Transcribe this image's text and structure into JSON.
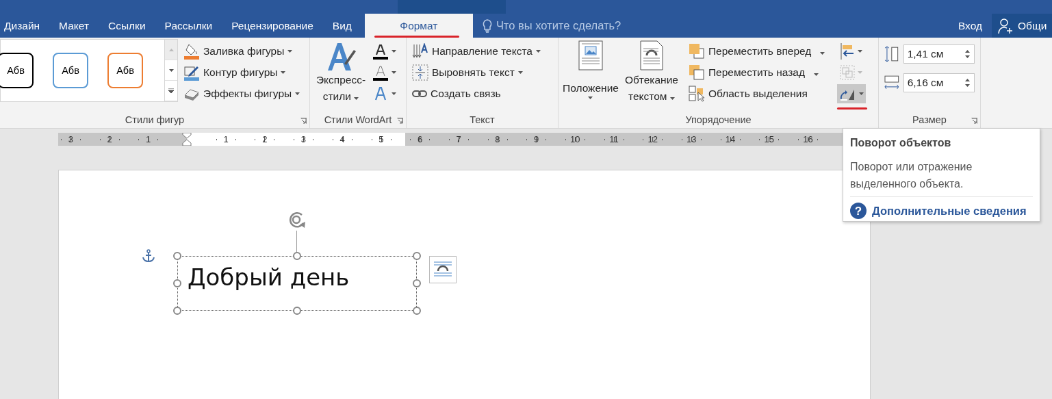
{
  "ribbon_tabs": [
    {
      "label": "Дизайн",
      "selected": false
    },
    {
      "label": "Макет",
      "selected": false
    },
    {
      "label": "Ссылки",
      "selected": false
    },
    {
      "label": "Рассылки",
      "selected": false
    },
    {
      "label": "Рецензирование",
      "selected": false
    },
    {
      "label": "Вид",
      "selected": false
    },
    {
      "label": "Формат",
      "selected": true
    }
  ],
  "tell_me": {
    "placeholder": "Что вы хотите сделать?"
  },
  "account": {
    "sign_in": "Вход",
    "share": "Общи"
  },
  "shape_styles": {
    "presets": [
      {
        "label": "Абв",
        "color": "#000000"
      },
      {
        "label": "Абв",
        "color": "#5b9bd5"
      },
      {
        "label": "Абв",
        "color": "#ed7d31"
      }
    ],
    "commands": [
      "Заливка фигуры",
      "Контур фигуры",
      "Эффекты фигуры"
    ],
    "group_label": "Стили фигур"
  },
  "wordart": {
    "quick_styles": "Экспресс-стили",
    "group_label": "Стили WordArt"
  },
  "text_group": {
    "commands": [
      "Направление текста",
      "Выровнять текст",
      "Создать связь"
    ],
    "group_label": "Текст"
  },
  "arrange": {
    "position": "Положение",
    "wrap_text": "Обтекание текстом",
    "commands": [
      "Переместить вперед",
      "Переместить назад",
      "Область выделения"
    ],
    "group_label": "Упорядочение"
  },
  "size": {
    "height": "1,41 см",
    "width": "6,16 см",
    "group_label": "Размер"
  },
  "ruler": {
    "left_numbers": [
      "3",
      "2",
      "1"
    ],
    "right_numbers": [
      "1",
      "2",
      "3",
      "4",
      "5",
      "6",
      "7",
      "8",
      "9",
      "10",
      "11",
      "12",
      "13",
      "14",
      "15",
      "16"
    ]
  },
  "document": {
    "text_box": "Добрый день"
  },
  "tooltip": {
    "help_glyph": "?",
    "title": "Поворот объектов",
    "description": "Поворот или отражение выделенного объекта.",
    "link": "Дополнительные сведения"
  }
}
